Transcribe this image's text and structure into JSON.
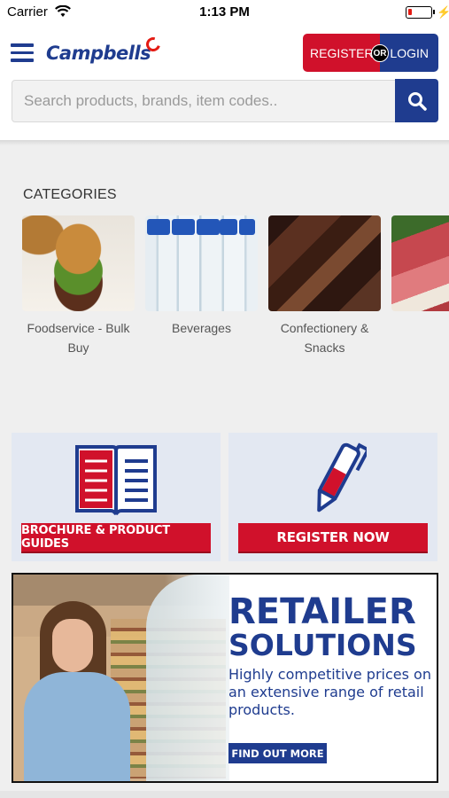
{
  "status_bar": {
    "carrier": "Carrier",
    "time": "1:13 PM",
    "charging_symbol": "⚡"
  },
  "header": {
    "logo_text": "Campbells",
    "register_label": "REGISTER",
    "or_label": "OR",
    "login_label": "LOGIN",
    "search_placeholder": "Search products, brands, item codes.."
  },
  "categories": {
    "title": "CATEGORIES",
    "items": [
      {
        "label": "Foodservice - Bulk Buy",
        "icon": "burger-photo"
      },
      {
        "label": "Beverages",
        "icon": "water-bottles-photo"
      },
      {
        "label": "Confectionery & Snacks",
        "icon": "chocolate-photo"
      },
      {
        "label": "",
        "icon": "deli-meat-photo"
      }
    ]
  },
  "promos": {
    "brochure_label": "BROCHURE & PRODUCT GUIDES",
    "register_label": "REGISTER NOW"
  },
  "banner": {
    "title_line1": "RETAILER",
    "title_line2": "SOLUTIONS",
    "description": "Highly competitive prices on an extensive range of retail products.",
    "cta_label": "FIND OUT MORE"
  },
  "colors": {
    "brand_blue": "#1f3c8f",
    "brand_red": "#d0112b",
    "battery_low": "#e41b13"
  }
}
